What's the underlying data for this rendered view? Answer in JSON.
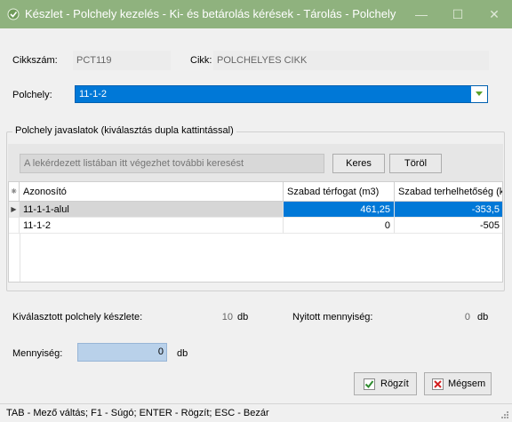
{
  "window": {
    "title": "Készlet - Polchely kezelés - Ki- és betárolás kérések - Tárolás - Polchely",
    "minimize_glyph": "—",
    "maximize_glyph": "☐",
    "close_glyph": "✕",
    "icon": "app-icon-green"
  },
  "item": {
    "code_label": "Cikkszám:",
    "code_value": "PCT119",
    "name_label": "Cikk:",
    "name_value": "POLCHELYES CIKK"
  },
  "location": {
    "label": "Polchely:",
    "selected": "11-1-2",
    "dropdown_icon": "triangle-down-icon"
  },
  "suggestions": {
    "group_title": "Polchely javaslatok (kiválasztás dupla kattintással)",
    "search_placeholder": "A lekérdezett listában itt végezhet további keresést",
    "search_button": "Keres",
    "clear_button": "Töröl",
    "columns": [
      "Azonosító",
      "Szabad térfogat (m3)",
      "Szabad terhelhetőség (k"
    ],
    "rows": [
      {
        "id": "11-1-1-alul",
        "free_volume": "461,25",
        "free_load": "-353,5",
        "selected": true
      },
      {
        "id": "11-1-2",
        "free_volume": "0",
        "free_load": "-505",
        "selected": false
      }
    ]
  },
  "stock": {
    "location_stock_label": "Kiválasztott polchely készlete:",
    "location_stock_value": "10",
    "location_stock_unit": "db",
    "open_qty_label": "Nyitott mennyiség:",
    "open_qty_value": "0",
    "open_qty_unit": "db"
  },
  "quantity": {
    "label": "Mennyiség:",
    "value": "0",
    "unit": "db"
  },
  "actions": {
    "save_label": "Rögzít",
    "cancel_label": "Mégsem"
  },
  "statusbar": {
    "text": "TAB - Mező váltás; F1 - Súgó; ENTER - Rögzít; ESC - Bezár"
  },
  "colors": {
    "titlebar": "#8fb27e",
    "selection": "#0078d7",
    "quantity_field": "#b9d1ea"
  }
}
